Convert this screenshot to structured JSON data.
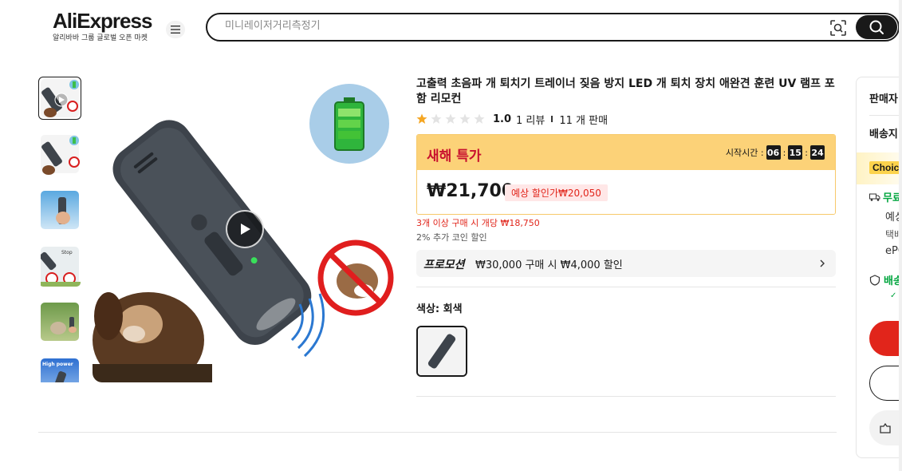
{
  "header": {
    "logo_text": "AliExpress",
    "logo_subtitle": "알리바바 그룹 글로벌 오픈 마켓",
    "search_placeholder": "미니레이저거리측정기"
  },
  "product": {
    "title": "고출력 초음파 개 퇴치기 트레이너 짖음 방지 LED 개 퇴치 장치 애완견 훈련 UV 램프 포함 리모컨",
    "rating": "1.0",
    "review_count": "1 리뷰",
    "sold_count": "11 개 판매",
    "stars_filled": 1,
    "stars_total": 5
  },
  "deal": {
    "title": "새해 특가",
    "timer_label": "시작시간 :",
    "timer_h": "06",
    "timer_m": "15",
    "timer_s": "24",
    "price": "₩21,700",
    "estimated": "예상 할인가₩20,050",
    "bulk_text": "3개 이상 구매 시 개당 ₩18,750",
    "coin_text": "2% 추가 코인 할인"
  },
  "promotion": {
    "label": "프로모션",
    "text": "₩30,000 구매 시 ₩4,000 할인"
  },
  "variant": {
    "color_label": "색상: 회색"
  },
  "side_panel": {
    "seller_label": "판매자",
    "shipping_label": "배송지:",
    "choice_tag": "Choice",
    "free_shipping": "무료",
    "line1": "예상",
    "line2": "택배",
    "line3": "ePC",
    "delivery_guarantee": "배송",
    "check_mark": "✓ I"
  },
  "colors": {
    "brand_red": "#e1251b",
    "deal_yellow": "#fcd278",
    "green": "#00a53e",
    "dark": "#191919"
  }
}
